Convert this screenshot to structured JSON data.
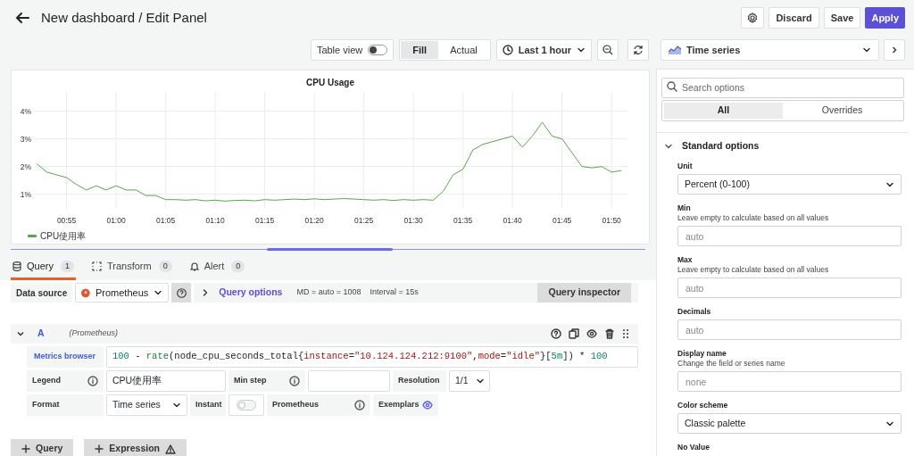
{
  "header": {
    "title": "New dashboard / Edit Panel",
    "buttons": [
      {
        "kind": "icon"
      },
      {
        "kind": "default",
        "label": "Discard"
      },
      {
        "kind": "default",
        "label": "Save"
      },
      {
        "kind": "primary",
        "label": "Apply"
      }
    ]
  },
  "toolbar": {
    "table_view": {
      "label": "Table view",
      "on": false
    },
    "size_modes": [
      {
        "label": "Fill",
        "selected": true
      },
      {
        "label": "Actual",
        "selected": false
      }
    ],
    "time_range": "Last 1 hour",
    "visualization": "Time series"
  },
  "panel": {
    "title": "CPU Usage",
    "chart_data": {
      "type": "line",
      "x": [
        52,
        53,
        54,
        55,
        56,
        57,
        58,
        59,
        60,
        61,
        62,
        63,
        64,
        65,
        66,
        67,
        68,
        69,
        70,
        71,
        72,
        73,
        74,
        75,
        76,
        77,
        78,
        79,
        80,
        81,
        82,
        83,
        84,
        85,
        86,
        87,
        88,
        89,
        90,
        91,
        92,
        93,
        94,
        95,
        96,
        97,
        98,
        99,
        100,
        101,
        102,
        103,
        104,
        105,
        106,
        107,
        108,
        109,
        110,
        111
      ],
      "series": [
        {
          "name": "CPU使用率",
          "color": "#56a64b",
          "values": [
            2.1,
            1.8,
            1.7,
            1.6,
            1.35,
            1.15,
            1.3,
            1.15,
            1.3,
            1.15,
            1.15,
            0.95,
            0.95,
            0.8,
            0.8,
            0.78,
            0.8,
            0.76,
            0.78,
            0.75,
            0.77,
            0.78,
            0.76,
            0.8,
            0.78,
            0.8,
            0.82,
            0.8,
            0.83,
            0.8,
            0.82,
            0.84,
            0.82,
            0.8,
            0.78,
            0.8,
            0.77,
            0.8,
            0.78,
            0.8,
            0.78,
            1.1,
            1.7,
            1.9,
            2.6,
            2.8,
            2.9,
            3.0,
            3.1,
            2.7,
            3.1,
            3.6,
            3.1,
            3.0,
            2.5,
            2.0,
            1.95,
            2.0,
            1.8,
            1.85
          ]
        }
      ],
      "xlim": [
        51.8,
        111.6
      ],
      "ylim": [
        0.5,
        4.7
      ],
      "grid": true,
      "xticks": [
        {
          "value": 55,
          "label": "00:55"
        },
        {
          "value": 60,
          "label": "01:00"
        },
        {
          "value": 65,
          "label": "01:05"
        },
        {
          "value": 70,
          "label": "01:10"
        },
        {
          "value": 75,
          "label": "01:15"
        },
        {
          "value": 80,
          "label": "01:20"
        },
        {
          "value": 85,
          "label": "01:25"
        },
        {
          "value": 90,
          "label": "01:30"
        },
        {
          "value": 95,
          "label": "01:35"
        },
        {
          "value": 100,
          "label": "01:40"
        },
        {
          "value": 105,
          "label": "01:45"
        },
        {
          "value": 110,
          "label": "01:50"
        }
      ],
      "yticks": [
        {
          "value": 1,
          "label": "1%"
        },
        {
          "value": 2,
          "label": "2%"
        },
        {
          "value": 3,
          "label": "3%"
        },
        {
          "value": 4,
          "label": "4%"
        }
      ]
    }
  },
  "query_tabs": [
    {
      "label": "Query",
      "count": "1",
      "selected": true
    },
    {
      "label": "Transform",
      "count": "0",
      "selected": false
    },
    {
      "label": "Alert",
      "count": "0",
      "selected": false
    }
  ],
  "data_source": {
    "label": "Data source",
    "value": "Prometheus",
    "query_options": "Query options",
    "max_data_points": "MD = auto = 1008",
    "interval": "Interval = 15s",
    "inspector": "Query inspector"
  },
  "query": {
    "letter": "A",
    "source": "(Prometheus)",
    "expanded": true,
    "metrics_browser": "Metrics browser",
    "expression": [
      {
        "kind": "number",
        "text": "100"
      },
      {
        "kind": "plain",
        "text": " - "
      },
      {
        "kind": "function",
        "text": "rate"
      },
      {
        "kind": "plain",
        "text": "(node_cpu_seconds_total{"
      },
      {
        "kind": "label",
        "text": "instance"
      },
      {
        "kind": "plain",
        "text": "="
      },
      {
        "kind": "string",
        "text": "\"10.124.124.212:9100\""
      },
      {
        "kind": "plain",
        "text": ","
      },
      {
        "kind": "label",
        "text": "mode"
      },
      {
        "kind": "plain",
        "text": "="
      },
      {
        "kind": "string",
        "text": "\"idle\""
      },
      {
        "kind": "plain",
        "text": "}["
      },
      {
        "kind": "number",
        "text": "5m"
      },
      {
        "kind": "plain",
        "text": "]) * "
      },
      {
        "kind": "number",
        "text": "100"
      }
    ],
    "legend": {
      "label": "Legend",
      "value": "CPU使用率"
    },
    "min_step": {
      "label": "Min step"
    },
    "resolution": {
      "label": "Resolution",
      "value": "1/1"
    },
    "format": {
      "label": "Format",
      "value": "Time series"
    },
    "instant": {
      "label": "Instant",
      "on": false
    },
    "type": "Prometheus",
    "exemplars": {
      "label": "Exemplars"
    }
  },
  "add_buttons": [
    {
      "label": "Query",
      "warning": false
    },
    {
      "label": "Expression",
      "warning": true
    }
  ],
  "options": {
    "search_placeholder": "Search options",
    "tabs": [
      {
        "label": "All",
        "selected": true
      },
      {
        "label": "Overrides",
        "selected": false
      }
    ],
    "section": {
      "title": "Standard options",
      "expanded": true
    },
    "fields": [
      {
        "kind": "select",
        "label": "Unit",
        "value": "Percent (0-100)"
      },
      {
        "kind": "input",
        "label": "Min",
        "description": "Leave empty to calculate based on all values",
        "placeholder": "auto"
      },
      {
        "kind": "input",
        "label": "Max",
        "description": "Leave empty to calculate based on all values",
        "placeholder": "auto"
      },
      {
        "kind": "input",
        "label": "Decimals",
        "placeholder": "auto"
      },
      {
        "kind": "input",
        "label": "Display name",
        "description": "Change the field or series name",
        "placeholder": "none"
      },
      {
        "kind": "select",
        "label": "Color scheme",
        "value": "Classic palette"
      },
      {
        "kind": "label",
        "label": "No Value"
      }
    ]
  }
}
